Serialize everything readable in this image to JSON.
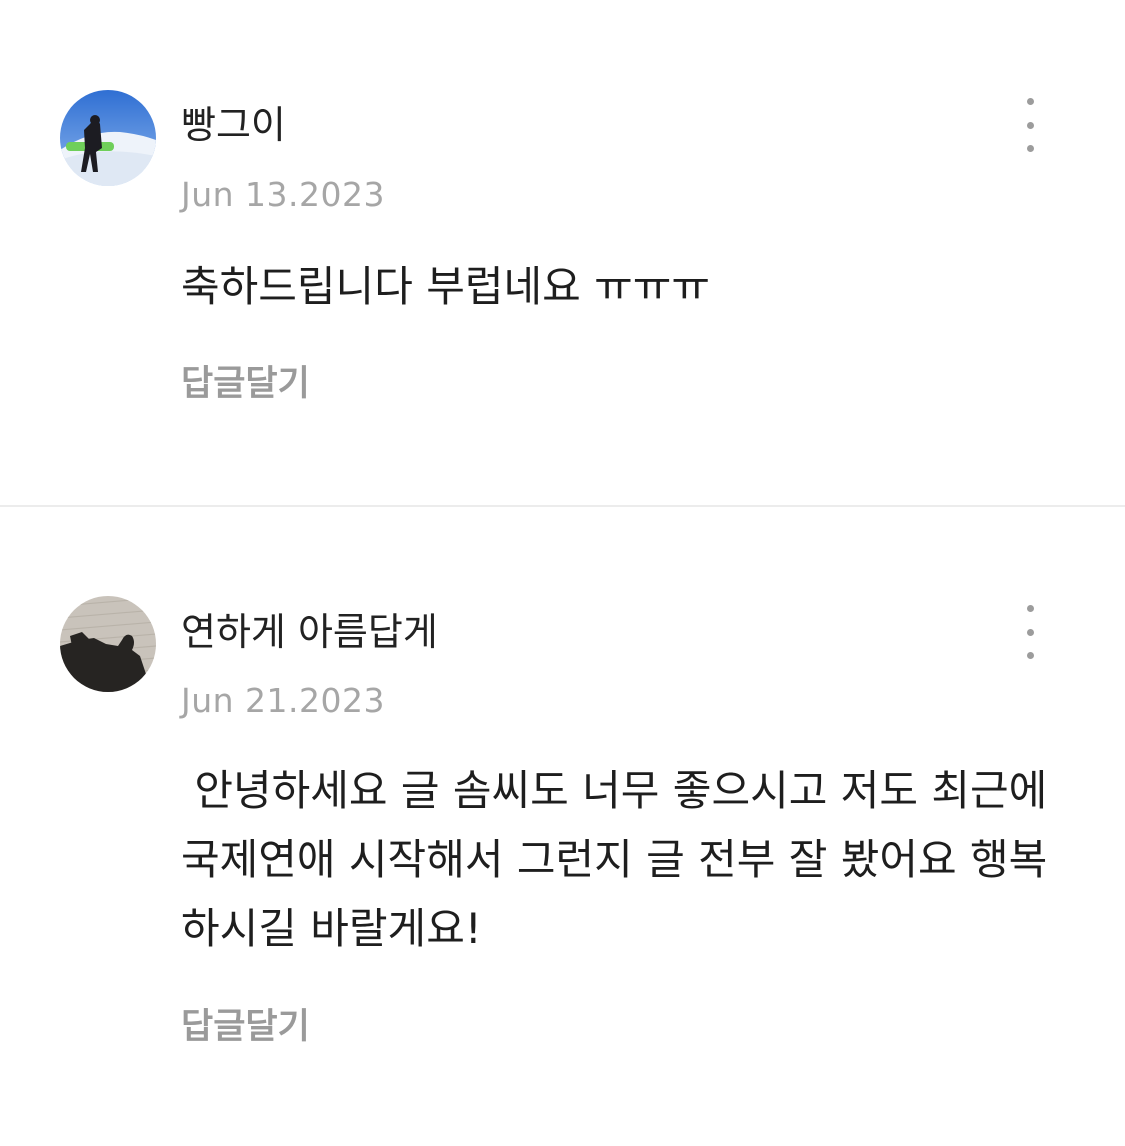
{
  "comments": [
    {
      "author": "빵그이",
      "date": "Jun 13.2023",
      "body": "축하드립니다 부럽네요 ㅠㅠㅠ",
      "reply_label": "답글달기",
      "avatar_icon": "avatar-snow-photo",
      "more_icon": "more-vertical-icon"
    },
    {
      "author": "연하게 아름답게",
      "date": "Jun 21.2023",
      "body": " 안녕하세요 글 솜씨도 너무 좋으시고 저도 최근에 국제연애 시작해서 그런지 글 전부 잘 봤어요 행복하시길 바랄게요!",
      "reply_label": "답글달기",
      "avatar_icon": "avatar-shadow-photo",
      "more_icon": "more-vertical-icon"
    }
  ],
  "colors": {
    "text": "#1e1e1e",
    "meta": "#a6a6a6",
    "reply": "#9a9a9a",
    "divider": "#ececec"
  }
}
